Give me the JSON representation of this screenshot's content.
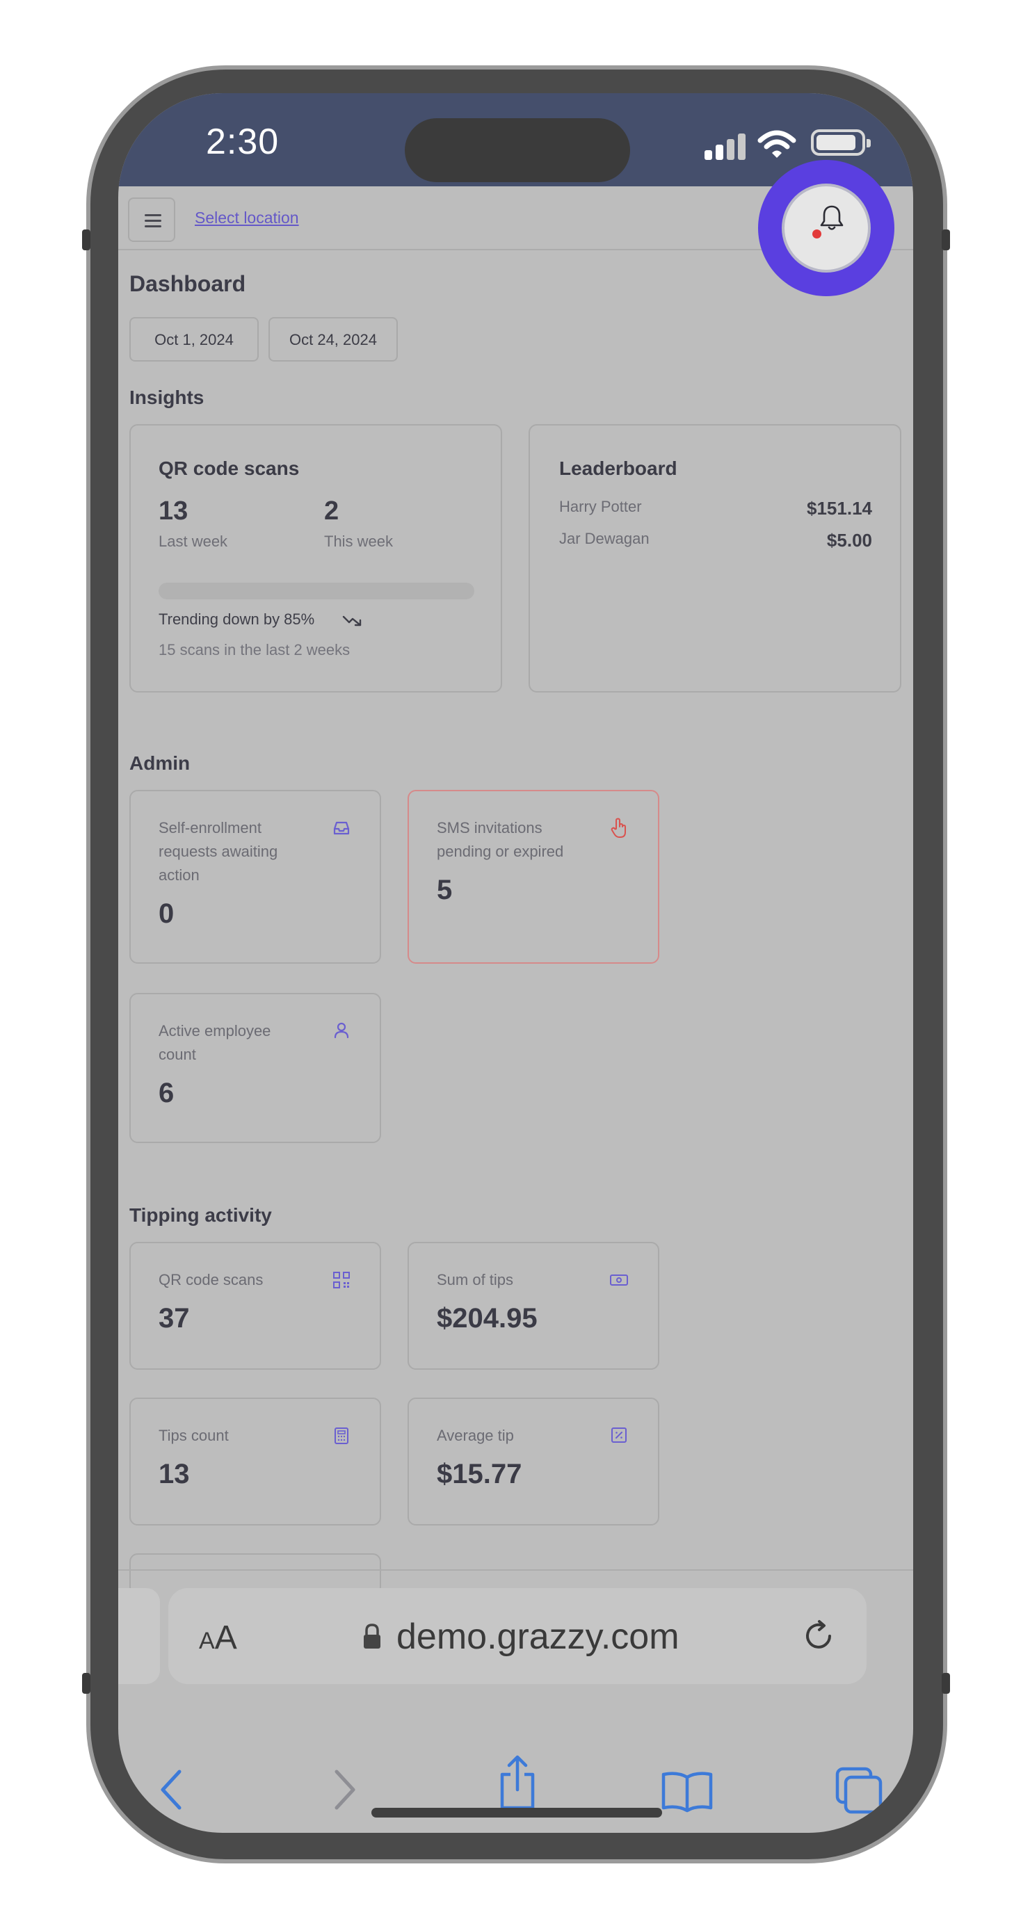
{
  "status_bar": {
    "time": "2:30"
  },
  "topbar": {
    "select_location": "Select location"
  },
  "dashboard": {
    "title": "Dashboard",
    "date_start": "Oct 1, 2024",
    "date_end": "Oct 24, 2024"
  },
  "insights": {
    "heading": "Insights",
    "qr_card": {
      "title": "QR code scans",
      "last_week_value": "13",
      "last_week_label": "Last week",
      "this_week_value": "2",
      "this_week_label": "This week",
      "trend_text": "Trending down by 85%",
      "summary": "15 scans in the last 2 weeks"
    },
    "leaderboard": {
      "title": "Leaderboard",
      "entries": [
        {
          "name": "Harry Potter",
          "amount": "$151.14"
        },
        {
          "name": "Jar Dewagan",
          "amount": "$5.00"
        }
      ]
    }
  },
  "admin": {
    "heading": "Admin",
    "cards": [
      {
        "label": "Self-enrollment requests awaiting action",
        "value": "0",
        "icon": "inbox-icon"
      },
      {
        "label": "SMS invitations pending or expired",
        "value": "5",
        "icon": "hand-pointer-icon",
        "accent": "#d9534f"
      },
      {
        "label": "Active employee count",
        "value": "6",
        "icon": "user-icon"
      }
    ]
  },
  "tipping": {
    "heading": "Tipping activity",
    "cards": [
      {
        "label": "QR code scans",
        "value": "37",
        "icon": "qr-code-icon"
      },
      {
        "label": "Sum of tips",
        "value": "$204.95",
        "icon": "banknote-icon"
      },
      {
        "label": "Tips count",
        "value": "13",
        "icon": "calculator-icon"
      },
      {
        "label": "Average tip",
        "value": "$15.77",
        "icon": "percent-square-icon"
      }
    ]
  },
  "browser": {
    "text_size_label": "AA",
    "url": "demo.grazzy.com"
  },
  "colors": {
    "accent": "#6a5fd0",
    "highlight_ring": "#5a3fe0",
    "status_bar": "#454f6c",
    "alert": "#d9534f",
    "browser_blue": "#3d7ad8"
  }
}
